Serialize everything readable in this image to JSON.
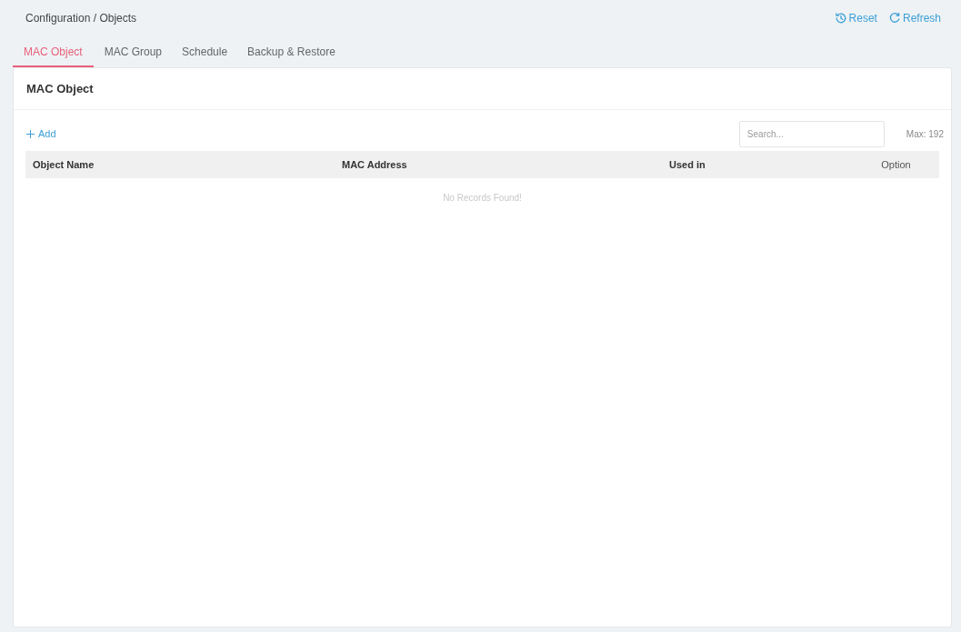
{
  "breadcrumb": "Configuration / Objects",
  "actions": [
    {
      "kind": "reset",
      "label": "Reset"
    },
    {
      "kind": "refresh",
      "label": "Refresh"
    }
  ],
  "tabs": [
    {
      "label": "MAC Object",
      "selected": true
    },
    {
      "label": "MAC Group",
      "selected": false
    },
    {
      "label": "Schedule",
      "selected": false
    },
    {
      "label": "Backup & Restore",
      "selected": false
    }
  ],
  "panel": {
    "title": "MAC Object",
    "add_label": "Add",
    "search": {
      "placeholder": "Search..."
    },
    "max": "Max: 192"
  },
  "table": {
    "columns": [
      "Object Name",
      "MAC Address",
      "Used in",
      "Option"
    ],
    "empty_message": "No Records Found!"
  }
}
